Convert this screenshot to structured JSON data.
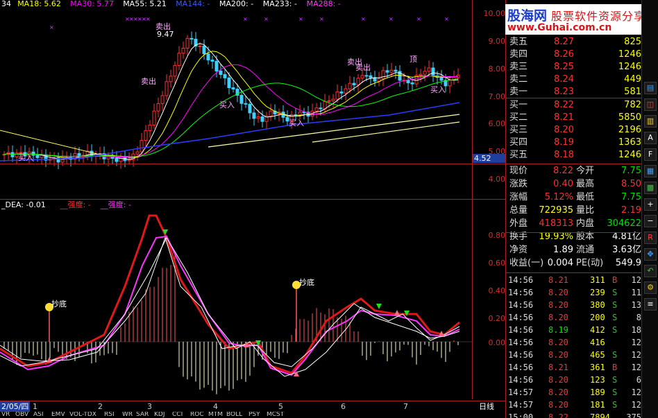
{
  "header": {
    "ma_labels": [
      {
        "text": "34",
        "color": "#ffffff"
      },
      {
        "text": "MA18: 5.62",
        "color": "#ffff00"
      },
      {
        "text": "MA30: 5.77",
        "color": "#ff00ff"
      },
      {
        "text": "MA55: 5.21",
        "color": "#ffffff"
      },
      {
        "text": "MA144: -",
        "color": "#3d5bff"
      },
      {
        "text": "MA200: -",
        "color": "#ffffff"
      },
      {
        "text": "MA233: -",
        "color": "#ffffff"
      },
      {
        "text": "MA288: -",
        "color": "#ff33ff"
      }
    ]
  },
  "indicator_header": [
    {
      "text": "_DEA: -0.01",
      "color": "#ffffff"
    },
    {
      "text": "__强度: -",
      "color": "#ff3030"
    },
    {
      "text": "__强度: -",
      "color": "#ff33ff"
    }
  ],
  "watermark": {
    "title": "股海网",
    "subtitle": "股票软件资源分享",
    "url": "www.Guhai.com.cn"
  },
  "price_axis": [
    "10.00",
    "9.00",
    "8.00",
    "7.00",
    "6.00",
    "5.00",
    "4.00"
  ],
  "price_current": "4.52",
  "indicator_axis": [
    "0.80",
    "0.60",
    "0.40",
    "0.20",
    "0.00"
  ],
  "chart_annotations": {
    "sell": [
      "卖出",
      "卖出",
      "卖出",
      "卖出",
      "顶"
    ],
    "buy": [
      "买入",
      "买入",
      "买入",
      "买入"
    ],
    "peak_value": "9.47",
    "bottom": [
      "抄底",
      "抄底"
    ]
  },
  "order_book": {
    "asks": [
      {
        "label": "卖五",
        "price": "8.27",
        "vol": "825"
      },
      {
        "label": "卖四",
        "price": "8.26",
        "vol": "1246"
      },
      {
        "label": "卖三",
        "price": "8.25",
        "vol": "1246"
      },
      {
        "label": "卖二",
        "price": "8.24",
        "vol": "449"
      },
      {
        "label": "卖一",
        "price": "8.23",
        "vol": "581"
      }
    ],
    "bids": [
      {
        "label": "买一",
        "price": "8.22",
        "vol": "782"
      },
      {
        "label": "买二",
        "price": "8.21",
        "vol": "5850"
      },
      {
        "label": "买三",
        "price": "8.20",
        "vol": "2196"
      },
      {
        "label": "买四",
        "price": "8.19",
        "vol": "1363"
      },
      {
        "label": "买五",
        "price": "8.18",
        "vol": "1246"
      }
    ]
  },
  "quote_stats": [
    {
      "l1": "现价",
      "v1": "8.22",
      "c1": "#ff3030",
      "l2": "今开",
      "v2": "7.75",
      "c2": "#00e000"
    },
    {
      "l1": "涨跌",
      "v1": "0.40",
      "c1": "#ff3030",
      "l2": "最高",
      "v2": "8.50",
      "c2": "#ff3030"
    },
    {
      "l1": "涨幅",
      "v1": "5.12%",
      "c1": "#ff3030",
      "l2": "最低",
      "v2": "7.75",
      "c2": "#00e000"
    },
    {
      "l1": "总量",
      "v1": "722935",
      "c1": "#ffff00",
      "l2": "量比",
      "v2": "2.19",
      "c2": "#ff3030"
    },
    {
      "l1": "外盘",
      "v1": "418313",
      "c1": "#ff3030",
      "l2": "内盘",
      "v2": "304622",
      "c2": "#00e000"
    },
    {
      "l1": "换手",
      "v1": "19.93%",
      "c1": "#ffff00",
      "l2": "股本",
      "v2": "4.81亿",
      "c2": "#ffffff"
    },
    {
      "l1": "净资",
      "v1": "1.89",
      "c1": "#ffffff",
      "l2": "流通",
      "v2": "3.63亿",
      "c2": "#ffffff"
    },
    {
      "l1": "收益(一)",
      "v1": "0.004",
      "c1": "#ffffff",
      "l2": "PE(动)",
      "v2": "549.9",
      "c2": "#ffffff"
    }
  ],
  "ticks": [
    {
      "time": "14:56",
      "price": "8.21",
      "vol": "311",
      "side": "B",
      "n": "12"
    },
    {
      "time": "14:56",
      "price": "8.20",
      "vol": "239",
      "side": "S",
      "n": "11"
    },
    {
      "time": "14:56",
      "price": "8.20",
      "vol": "380",
      "side": "S",
      "n": "13"
    },
    {
      "time": "14:56",
      "price": "8.20",
      "vol": "200",
      "side": "S",
      "n": "8"
    },
    {
      "time": "14:56",
      "price": "8.19",
      "vol": "412",
      "side": "S",
      "n": "18"
    },
    {
      "time": "14:56",
      "price": "8.20",
      "vol": "416",
      "side": "",
      "n": "12"
    },
    {
      "time": "14:56",
      "price": "8.20",
      "vol": "465",
      "side": "S",
      "n": "12"
    },
    {
      "time": "14:56",
      "price": "8.21",
      "vol": "361",
      "side": "B",
      "n": "12"
    },
    {
      "time": "14:56",
      "price": "8.20",
      "vol": "123",
      "side": "S",
      "n": "6"
    },
    {
      "time": "14:57",
      "price": "8.20",
      "vol": "189",
      "side": "S",
      "n": "12"
    },
    {
      "time": "14:57",
      "price": "8.20",
      "vol": "181",
      "side": "S",
      "n": "12"
    },
    {
      "time": "15:00",
      "price": "8.22",
      "vol": "7894",
      "side": "",
      "n": "375"
    }
  ],
  "date_axis": {
    "start": "2/05/四",
    "months": [
      "1",
      "2",
      "3",
      "4",
      "5",
      "6",
      "7"
    ],
    "period": "日线"
  },
  "indicator_tabs": [
    "VR",
    "OBV",
    "ASI",
    "EMV",
    "VOL-TDX",
    "RSI",
    "WR",
    "SAR",
    "KDJ",
    "CCI",
    "ROC",
    "MTM",
    "BOLL",
    "PSY",
    "MCST"
  ],
  "toolbar_icons": [
    "chart-icon",
    "kline-icon",
    "bar-icon",
    "text-icon",
    "f10-icon",
    "table-icon",
    "grid-icon",
    "zoom-in-icon",
    "zoom-out-icon",
    "rsi-icon",
    "move-icon",
    "back-icon",
    "settings-icon",
    "list-icon"
  ],
  "colors": {
    "up": "#ff3030",
    "down": "#00e000",
    "axis": "#aa1f1f",
    "background": "#000000",
    "vol_accent": "#ffff00"
  }
}
